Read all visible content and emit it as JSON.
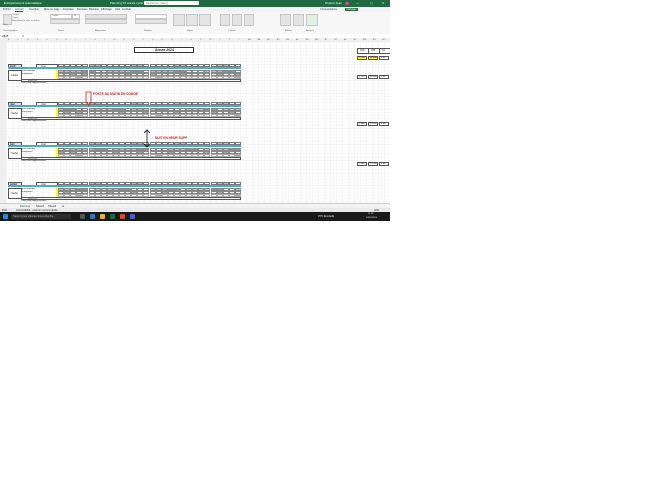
{
  "window": {
    "app_name": "Enregistrement automatique",
    "file_title": "Planning ST année cycle 4 · ...",
    "search_placeholder": "Rechercher (Alt+Q)",
    "user": "Dupont Jean",
    "share_label": "Partager",
    "comments_label": "Commentaires"
  },
  "menu": {
    "items": [
      "Fichier",
      "Accueil",
      "Insertion",
      "Mise en page",
      "Formules",
      "Données",
      "Révision",
      "Affichage",
      "Aide",
      "Acrobat"
    ],
    "active_index": 1
  },
  "ribbon": {
    "font_name": "Calibri",
    "font_size": "11",
    "groups": [
      "Presse-papiers",
      "Police",
      "Alignement",
      "Nombre",
      "Styles",
      "Cellules",
      "Édition",
      "Analyse"
    ],
    "buttons": [
      "Coller",
      "Couper",
      "Copier",
      "Reproduire la mise en forme",
      "Mise en forme conditionnelle",
      "Mettre sous forme de tableau",
      "Styles de cellules",
      "Insérer",
      "Supprimer",
      "Format",
      "Trier et filtrer",
      "Rechercher et sélectionner",
      "Analyser les données"
    ]
  },
  "formula_bar": {
    "name_box": "AB25",
    "fx": "fx",
    "value": ""
  },
  "sheet": {
    "title": "Année 2024",
    "column_letters": [
      "B",
      "C",
      "D",
      "E",
      "F",
      "G",
      "H",
      "I",
      "J",
      "K",
      "L",
      "M",
      "N",
      "O",
      "P",
      "Q",
      "R",
      "S",
      "T",
      "U",
      "V",
      "W",
      "X",
      "Y",
      "Z",
      "AA",
      "AB",
      "AC",
      "AD",
      "AE",
      "AF",
      "AG",
      "AH",
      "AI",
      "AJ",
      "AK",
      "AL",
      "AM",
      "AN",
      "AO"
    ],
    "months": [
      "avril",
      "mai",
      "juin",
      "juillet"
    ],
    "jour_label": "Jour",
    "cadre_label": "Cadre",
    "cycle_label": "cycle historique",
    "changement_label": "changement",
    "postes_supp_label": "Postes supplémentaires",
    "code_poste_label": "Code poste supplémentaire",
    "conges_label": "Congés",
    "annotations": [
      "POSTE DU MATIN EN CONGE",
      "NUIT EN HEUR SUPP"
    ],
    "right_headers": [
      "400",
      "405",
      "42"
    ],
    "right_values": [
      "1,156",
      "96,000",
      "9,00",
      "2,716",
      "36,000",
      "9,00",
      "5,848",
      "20,000",
      "9,00",
      "1,460",
      "22,000",
      "9,00",
      "3,785",
      "20,000",
      "9,00"
    ]
  },
  "sheet_tabs": [
    "Planning",
    "Sheet1",
    "Sheet2"
  ],
  "status": {
    "ready": "Prêt",
    "accessibility": "Accessibilité : examen recommandé",
    "zoom": "40%"
  },
  "taskbar": {
    "search_placeholder": "Taper ici pour effectuer une recherche",
    "weather": "15°C  Ensoleillé",
    "time": "11:06",
    "date": "10/10/2024"
  },
  "colors": {
    "excel_green": "#1e6b41",
    "header_blue": "#4bacc6",
    "cell_yellow": "#ffff00",
    "cell_orange": "#f4b183",
    "cell_green": "#a9d08e",
    "cell_grey": "#a6a6a6",
    "annotation_red": "#d01c1c"
  }
}
